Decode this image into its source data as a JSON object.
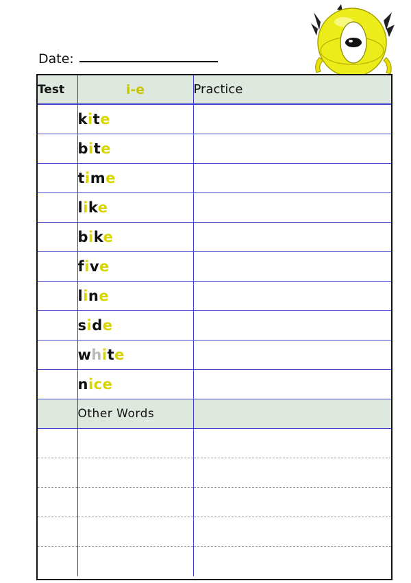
{
  "header": {
    "date_label": "Date:"
  },
  "table": {
    "col_test": "Test",
    "col_pattern": "i-e",
    "col_practice": "Practice",
    "words": [
      [
        {
          "t": "k",
          "c": "k"
        },
        {
          "t": "i",
          "c": "y"
        },
        {
          "t": "t",
          "c": "k"
        },
        {
          "t": "e",
          "c": "y"
        }
      ],
      [
        {
          "t": "b",
          "c": "k"
        },
        {
          "t": "i",
          "c": "y"
        },
        {
          "t": "t",
          "c": "k"
        },
        {
          "t": "e",
          "c": "y"
        }
      ],
      [
        {
          "t": "t",
          "c": "k"
        },
        {
          "t": "i",
          "c": "y"
        },
        {
          "t": "m",
          "c": "k"
        },
        {
          "t": "e",
          "c": "y"
        }
      ],
      [
        {
          "t": "l",
          "c": "k"
        },
        {
          "t": "i",
          "c": "y"
        },
        {
          "t": "k",
          "c": "k"
        },
        {
          "t": "e",
          "c": "y"
        }
      ],
      [
        {
          "t": "b",
          "c": "k"
        },
        {
          "t": "i",
          "c": "y"
        },
        {
          "t": "k",
          "c": "k"
        },
        {
          "t": "e",
          "c": "y"
        }
      ],
      [
        {
          "t": "f",
          "c": "k"
        },
        {
          "t": "i",
          "c": "y"
        },
        {
          "t": "v",
          "c": "k"
        },
        {
          "t": "e",
          "c": "y"
        }
      ],
      [
        {
          "t": "l",
          "c": "k"
        },
        {
          "t": "i",
          "c": "y"
        },
        {
          "t": "n",
          "c": "k"
        },
        {
          "t": "e",
          "c": "y"
        }
      ],
      [
        {
          "t": "s",
          "c": "k"
        },
        {
          "t": "i",
          "c": "y"
        },
        {
          "t": "d",
          "c": "k"
        },
        {
          "t": "e",
          "c": "y"
        }
      ],
      [
        {
          "t": "w",
          "c": "k"
        },
        {
          "t": "h",
          "c": "w"
        },
        {
          "t": "i",
          "c": "y"
        },
        {
          "t": "t",
          "c": "k"
        },
        {
          "t": "e",
          "c": "y"
        }
      ],
      [
        {
          "t": "n",
          "c": "k"
        },
        {
          "t": "i",
          "c": "y"
        },
        {
          "t": "c",
          "c": "y"
        },
        {
          "t": "e",
          "c": "y"
        }
      ]
    ],
    "other_words_label": "Other Words",
    "blank_rows": 5
  },
  "colors": {
    "grid_line": "#3a3fd0",
    "header_bg": "#dfe8de",
    "vowel": "#d8d500"
  },
  "decor": {
    "monster": "one-eyed-yellow-monster-icon"
  }
}
